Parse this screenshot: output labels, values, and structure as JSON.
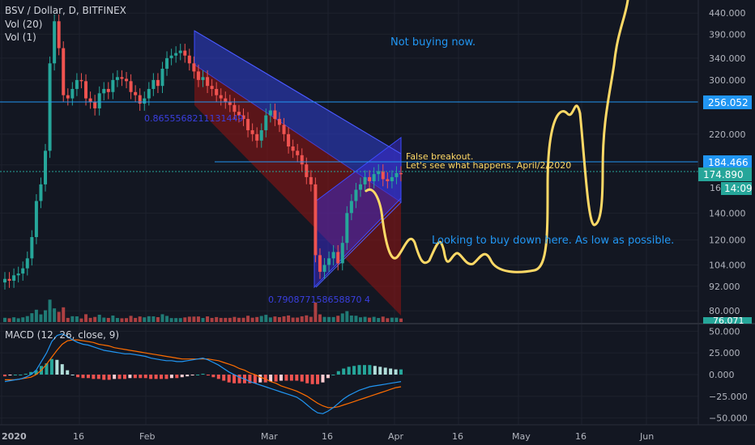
{
  "header": {
    "symbol": "BSV / Dollar, D, BITFINEX",
    "vol20": "Vol (20)",
    "vol1": "Vol (1)",
    "macd_label": "MACD (12, 26, close, 9)"
  },
  "colors": {
    "background": "#131722",
    "up_candle": "#26a69a",
    "down_candle": "#ef5350",
    "macd_line": "#2196f3",
    "signal_line": "#ff6d00",
    "channel_blue": "#2f3fd6",
    "channel_red": "#8b1414",
    "annotation_blue": "#2196f3",
    "annotation_orange": "#ffd966",
    "drawing_yellow": "#ffd966",
    "hline": "#2196f3",
    "axis_text": "#b2b5be"
  },
  "annotations": {
    "not_buying": "Not buying now.",
    "false_breakout": "False breakout.",
    "lets_see": "Let's see what happens. April/2/2020",
    "looking_to_buy": "Looking to buy down here. As low as possible.",
    "fib_top": "0.8655568211131449",
    "fib_bottom": "0.790877158658870 4"
  },
  "price_labels": {
    "hline_price": "256.052",
    "level_price": "184.466",
    "last_price": "174.890",
    "countdown": "14:09",
    "partial": "16",
    "bottom_partial": "76.071"
  },
  "chart_data": [
    {
      "type": "line",
      "title": "BSV / Dollar, D, BITFINEX",
      "scale": "log",
      "y_ticks": [
        "440.000",
        "390.000",
        "340.000",
        "300.000",
        "256.052",
        "220.000",
        "184.466",
        "174.890",
        "140.000",
        "120.000",
        "104.000",
        "92.000",
        "80.000"
      ],
      "x_ticks": [
        "2020",
        "16",
        "Feb",
        "Mar",
        "16",
        "Apr",
        "16",
        "May",
        "16",
        "Jun"
      ],
      "ylim": [
        75,
        470
      ],
      "close": [
        96,
        95,
        98,
        99,
        102,
        108,
        122,
        150,
        165,
        200,
        330,
        420,
        360,
        275,
        270,
        285,
        300,
        298,
        270,
        265,
        255,
        278,
        285,
        280,
        300,
        305,
        302,
        298,
        280,
        275,
        262,
        270,
        285,
        300,
        290,
        320,
        340,
        345,
        350,
        355,
        345,
        330,
        315,
        300,
        305,
        290,
        285,
        275,
        270,
        265,
        260,
        250,
        245,
        240,
        225,
        220,
        212,
        225,
        245,
        252,
        240,
        232,
        220,
        205,
        200,
        195,
        185,
        172,
        165,
        110,
        100,
        104,
        108,
        112,
        105,
        118,
        140,
        150,
        160,
        165,
        172,
        168,
        175,
        178,
        170,
        168,
        172,
        176,
        174.89
      ],
      "series": [
        {
          "name": "MACD",
          "values": [
            -8,
            -7,
            -6,
            -5,
            -3,
            0,
            5,
            15,
            25,
            38,
            45,
            47,
            44,
            40,
            37,
            35,
            34,
            32,
            30,
            28,
            27,
            26,
            25,
            24,
            24,
            23,
            22,
            21,
            19,
            18,
            17,
            16,
            16,
            15,
            15,
            16,
            17,
            18,
            19,
            17,
            14,
            11,
            7,
            3,
            0,
            -3,
            -5,
            -8,
            -10,
            -12,
            -14,
            -16,
            -18,
            -20,
            -22,
            -24,
            -26,
            -30,
            -35,
            -40,
            -44,
            -45,
            -42,
            -38,
            -33,
            -28,
            -24,
            -21,
            -18,
            -16,
            -14,
            -13,
            -12,
            -11,
            -10,
            -9,
            -8
          ]
        },
        {
          "name": "Signal",
          "values": [
            -6,
            -6,
            -6,
            -5,
            -4,
            -3,
            0,
            5,
            12,
            20,
            28,
            35,
            39,
            40,
            40,
            39,
            38,
            37,
            35,
            34,
            33,
            31,
            30,
            29,
            28,
            27,
            26,
            25,
            24,
            23,
            22,
            21,
            20,
            19,
            18,
            18,
            18,
            18,
            18,
            18,
            17,
            16,
            14,
            12,
            10,
            7,
            5,
            2,
            0,
            -3,
            -5,
            -8,
            -10,
            -13,
            -15,
            -17,
            -19,
            -22,
            -25,
            -29,
            -33,
            -36,
            -38,
            -38,
            -37,
            -35,
            -33,
            -31,
            -29,
            -27,
            -25,
            -23,
            -21,
            -19,
            -17,
            -15,
            -14
          ]
        },
        {
          "name": "Histogram",
          "values": [
            -2,
            -1,
            0,
            0,
            1,
            3,
            5,
            10,
            13,
            18,
            17,
            12,
            5,
            0,
            -3,
            -4,
            -4,
            -5,
            -5,
            -6,
            -6,
            -5,
            -5,
            -5,
            -4,
            -4,
            -4,
            -4,
            -5,
            -5,
            -5,
            -5,
            -4,
            -4,
            -3,
            -2,
            -1,
            0,
            1,
            -1,
            -3,
            -5,
            -7,
            -9,
            -10,
            -10,
            -10,
            -10,
            -10,
            -9,
            -9,
            -8,
            -8,
            -7,
            -7,
            -7,
            -7,
            -8,
            -10,
            -11,
            -11,
            -9,
            -4,
            0,
            4,
            7,
            9,
            10,
            11,
            11,
            11,
            10,
            9,
            8,
            7,
            6,
            6
          ]
        }
      ],
      "macd_y_ticks": [
        "50.000",
        "25.000",
        "0.000",
        "−25.000",
        "−50.000"
      ]
    }
  ]
}
